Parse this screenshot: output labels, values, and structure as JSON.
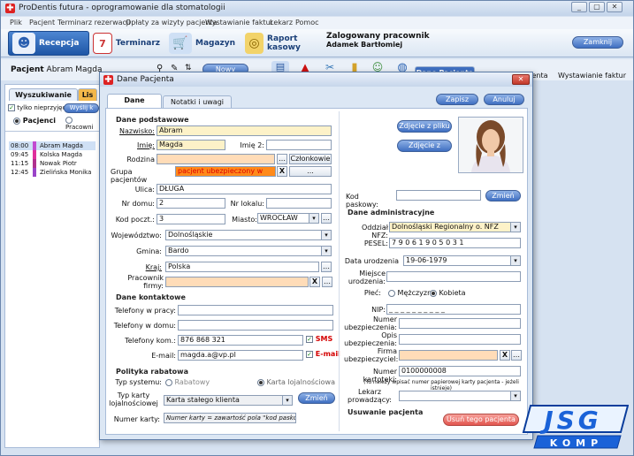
{
  "app": {
    "title": "ProDentis futura - oprogramowanie dla stomatologii"
  },
  "window_buttons": [
    "_",
    "▢",
    "✕"
  ],
  "menu": [
    "Plik",
    "Pacjent",
    "Terminarz rezerwacji",
    "Opłaty za wizyty pacjenta",
    "Wystawianie faktur",
    "Lekarz",
    "Pomoc"
  ],
  "toolbar": {
    "recepcja": "Recepcja",
    "terminarz": "Terminarz",
    "magazyn": "Magazyn",
    "raport": "Raport kasowy",
    "logged_label": "Zalogowany pracownik",
    "logged_user": "Adamek Bartłomiej",
    "close": "Zamknij"
  },
  "patientbar": {
    "label": "Pacjent",
    "name": "Abram Magda",
    "new_patient": "Nowy pacjent",
    "tabs": [
      "Dane Pacjenta",
      "Karta pacjenta",
      "Wystawianie faktur"
    ]
  },
  "left": {
    "tabs": [
      "Wyszukiwanie",
      "Lis"
    ],
    "only_unpaid": "tylko nieprzyjęci",
    "search_btn": "Wyślij k",
    "radio_patients": "Pacjenci",
    "radio_workers": "Pracowni",
    "appointments": [
      {
        "time": "08:00",
        "name": "Abram Magda",
        "color": "#c24ad0"
      },
      {
        "time": "09:45",
        "name": "Kolska Magda",
        "color": "#e0309c"
      },
      {
        "time": "11:15",
        "name": "Nowak Piotr",
        "color": "#b0308e"
      },
      {
        "time": "12:45",
        "name": "Zielińska Monika",
        "color": "#9a44c8"
      }
    ]
  },
  "dialog": {
    "title": "Dane Pacjenta",
    "tabs": [
      "Dane pacjenta",
      "Notatki i uwagi lekarza"
    ],
    "save": "Zapisz",
    "cancel": "Anuluj",
    "sec_basic": "Dane podstawowe",
    "nazwisko_l": "Nazwisko:",
    "nazwisko": "Abram",
    "imie_l": "Imię:",
    "imie": "Magda",
    "imie2_l": "Imię 2:",
    "imie2": "",
    "rodzina_l": "Rodzina",
    "czlonkowie": "Członkowie",
    "grupa_l": "Grupa pacjentów",
    "grupa": "pacjent ubezpieczony w",
    "ulica_l": "Ulica:",
    "ulica": "DŁUGA",
    "nrdomu_l": "Nr domu:",
    "nrdomu": "2",
    "nrlokalu_l": "Nr lokalu:",
    "nrlokalu": "",
    "kod_l": "Kod poczt.:",
    "kod": "3",
    "miasto_l": "Miasto:",
    "miasto": "WROCŁAW",
    "woj_l": "Województwo:",
    "woj": "Dolnośląskie",
    "gmina_l": "Gmina:",
    "gmina": "Bardo",
    "kraj_l": "Kraj:",
    "kraj": "Polska",
    "pracownik_l": "Pracownik firmy:",
    "sec_contact": "Dane kontaktowe",
    "tel_praca_l": "Telefony w pracy:",
    "tel_dom_l": "Telefony w domu:",
    "tel_kom_l": "Telefony kom.:",
    "tel_kom": "876 868 321",
    "sms": "SMS",
    "email_l": "E-mail:",
    "email": "magda.a@vp.pl",
    "email_chk": "E-mail",
    "sec_rabat": "Polityka rabatowa",
    "typ_sys_l": "Typ systemu:",
    "rabatowy": "Rabatowy",
    "karta_loj": "Karta lojalnościowa",
    "typ_karty_l": "Typ karty lojalnościowej",
    "typ_karty": "Karta stałego klienta",
    "zmien": "Zmień",
    "numer_karty_l": "Numer karty:",
    "numer_karty": "Numer karty = zawartość pola \"kod paskowy\"",
    "photo_file": "Zdjęcie z pliku",
    "photo_camera": "Zdjęcie z kamery",
    "kod_pask_l": "Kod paskowy:",
    "kod_pask_btn": "Zmień",
    "sec_admin": "Dane administracyjne",
    "nfz_l": "Oddział NFZ:",
    "nfz": "Dolnośląski Regionalny o. NFZ",
    "pesel_l": "PESEL:",
    "pesel": "7 9 0 6 1 9 0 5 0 3 1",
    "data_ur_l": "Data urodzenia",
    "data_ur": "19-06-1979",
    "miejsce_l": "Miejsce urodzenia:",
    "plec_l": "Płeć:",
    "mezczyzna": "Mężczyzna",
    "kobieta": "Kobieta",
    "nip_l": "NIP:",
    "nip": "_ _ _ _ _ _ _ _ _ _",
    "nr_ubezp_l": "Numer ubezpieczenia:",
    "opis_ubezp_l": "Opis ubezpieczenia:",
    "firma_ubezp_l": "Firma ubezpieczyciel:",
    "nr_kart_l": "Numer kartoteki:",
    "nr_kart": "0100000008",
    "nr_kart_hint": "(Tu należy wpisać numer papierowej karty pacjenta - jeżeli istnieje)",
    "lekarz_l": "Lekarz prowadzący:",
    "sec_usuwanie": "Usuwanie pacjenta",
    "usun": "Usuń tego pacjenta"
  },
  "logo": {
    "top": "JSG",
    "bottom": "KOMP"
  },
  "colors": {
    "accent": "#3f6fc1",
    "required_bg": "#fdf2c8",
    "orange_bg": "#ffdcb8",
    "red": "#d40000"
  }
}
